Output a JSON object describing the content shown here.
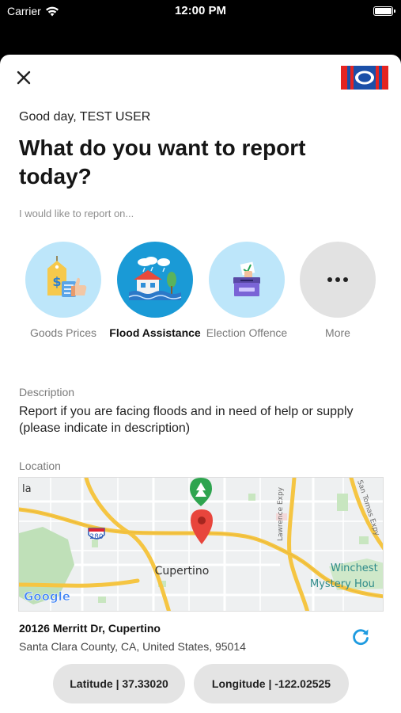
{
  "status": {
    "carrier": "Carrier",
    "time": "12:00 PM"
  },
  "header": {
    "close_icon": "close-icon",
    "logo": "party-logo"
  },
  "greeting": "Good day, TEST USER",
  "title": "What do you want to report today?",
  "subtitle": "I would like to report on...",
  "categories": [
    {
      "label": "Goods Prices",
      "icon": "price-tag-icon",
      "selected": false
    },
    {
      "label": "Flood Assistance",
      "icon": "flood-house-icon",
      "selected": true
    },
    {
      "label": "Election Offence",
      "icon": "ballot-box-icon",
      "selected": false
    },
    {
      "label": "More",
      "icon": "more-icon",
      "selected": false
    }
  ],
  "description": {
    "label": "Description",
    "text": "Report if you are facing floods and in need of help or supply (please indicate in description)"
  },
  "location": {
    "label": "Location",
    "map_labels": {
      "left_edge": "la",
      "highway": "280",
      "city": "Cupertino",
      "lawrence": "Lawrence Expy",
      "san_tomas": "San Tomas Expy",
      "winchester": "Winchest",
      "mystery": "Mystery Hou",
      "google": "Google"
    },
    "address_line1": "20126 Merritt Dr, Cupertino",
    "address_line2": "Santa Clara County, CA, United States, 95014",
    "latitude": "Latitude | 37.33020",
    "longitude": "Longitude | -122.02525"
  },
  "colors": {
    "accent_blue": "#1e9be0",
    "flood_circle": "#1a9ad6",
    "light_circle": "#bde6fa",
    "more_circle": "#e2e2e2",
    "pin_red": "#e8453c",
    "road_yellow": "#f5c542"
  }
}
